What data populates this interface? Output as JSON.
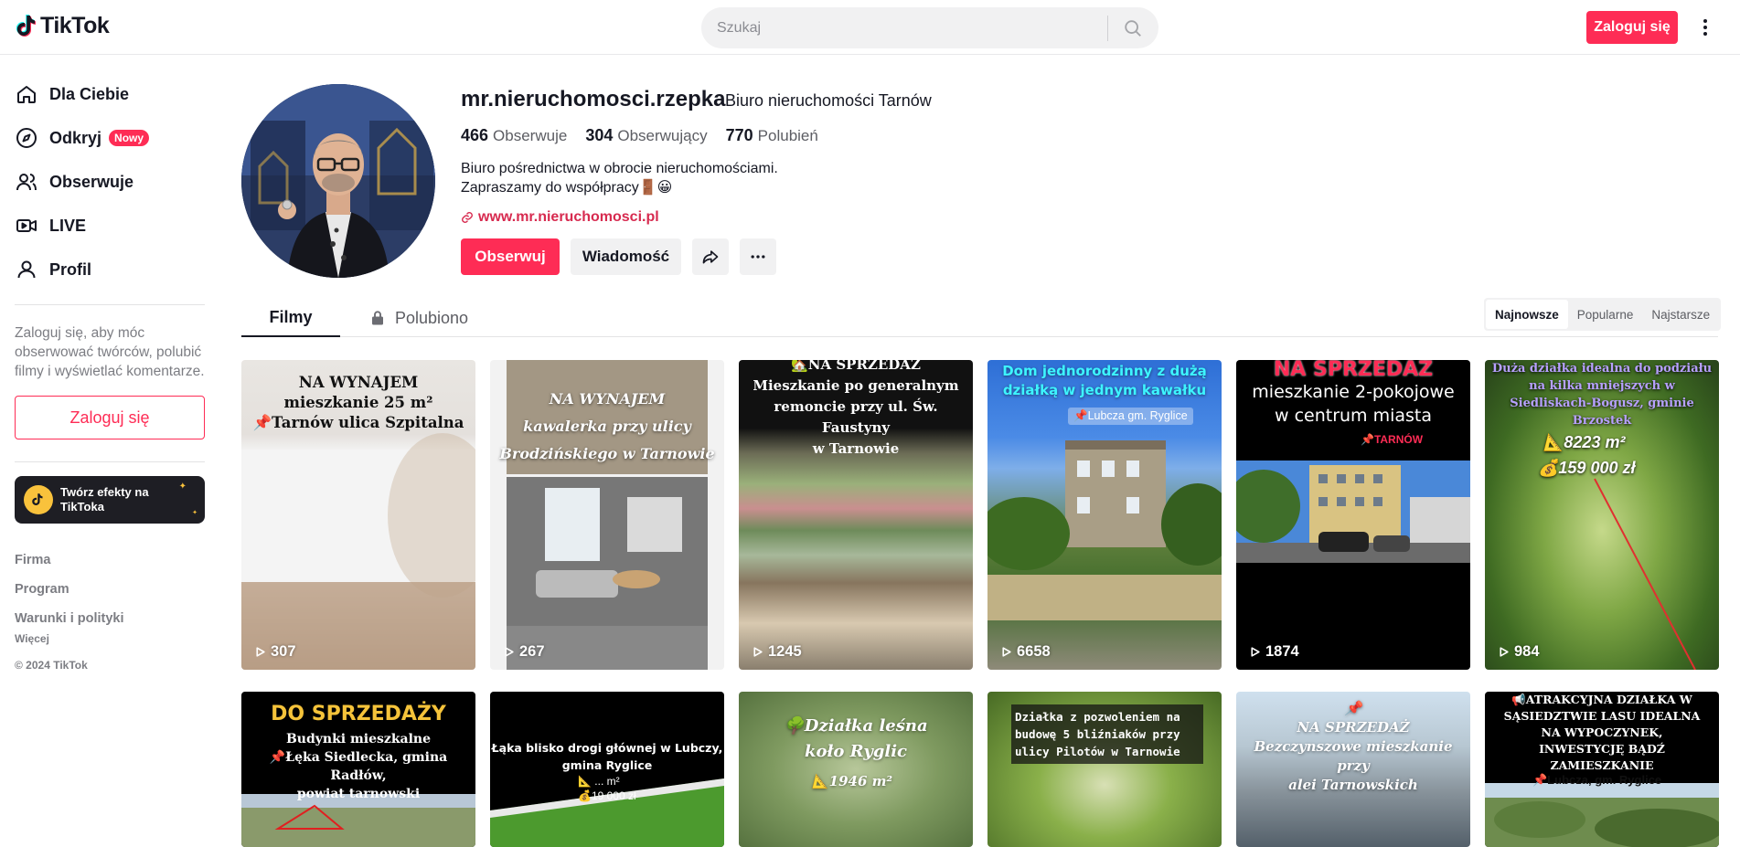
{
  "header": {
    "logo_text": "TikTok",
    "search_placeholder": "Szukaj",
    "login_label": "Zaloguj się"
  },
  "sidebar": {
    "items": [
      {
        "label": "Dla Ciebie",
        "icon": "home-icon"
      },
      {
        "label": "Odkryj",
        "icon": "compass-icon",
        "badge": "Nowy"
      },
      {
        "label": "Obserwuje",
        "icon": "users-icon"
      },
      {
        "label": "LIVE",
        "icon": "live-icon"
      },
      {
        "label": "Profil",
        "icon": "user-icon"
      }
    ],
    "login_hint": "Zaloguj się, aby móc obserwować twórców, polubić filmy i wyświetlać komentarze.",
    "login_label": "Zaloguj się",
    "effects_label": "Twórz efekty na TikToka",
    "footer": [
      "Firma",
      "Program",
      "Warunki i polityki"
    ],
    "more": "Więcej",
    "copyright": "© 2024 TikTok"
  },
  "profile": {
    "username": "mr.nieruchomosci.rzepka",
    "nickname": "Biuro nieruchomości Tarnów",
    "following_count": "466",
    "following_label": "Obserwuje",
    "followers_count": "304",
    "followers_label": "Obserwujący",
    "likes_count": "770",
    "likes_label": "Polubień",
    "bio_line1": "Biuro pośrednictwa w obrocie nieruchomościami.",
    "bio_line2": "Zapraszamy do współpracy🚪😀",
    "link": "www.mr.nieruchomosci.pl",
    "follow_label": "Obserwuj",
    "message_label": "Wiadomość"
  },
  "tabs": {
    "videos": "Filmy",
    "liked": "Polubiono"
  },
  "sort": [
    "Najnowsze",
    "Popularne",
    "Najstarsze"
  ],
  "videos": [
    {
      "caption": "NA WYNAJEM\nmieszkanie 25 m²\n📌Tarnów ulica Szpitalna",
      "views": "307"
    },
    {
      "caption": "NA WYNAJEM\nkawalerka przy ulicy\nBrodzińskiego w Tarnowie",
      "views": "267"
    },
    {
      "caption": "🏡NA SPRZEDAŻ\nMieszkanie po generalnym\nremoncie przy ul. Św. Faustyny\nw Tarnowie",
      "views": "1245"
    },
    {
      "caption": "Dom jednorodzinny z dużą\ndziałką w jednym kawałku",
      "tag": "📌Lubcza gm. Ryglice",
      "views": "6658"
    },
    {
      "caption": "NA SPRZEDAŻ",
      "subcaption": "mieszkanie 2-pokojowe\nw centrum miasta",
      "tag": "📌TARNÓW",
      "views": "1874"
    },
    {
      "caption": "Duża działka idealna do podziału\nna kilka mniejszych w\nSiedliskach-Bogusz, gminie\nBrzostek",
      "area": "📐8223 m²",
      "price": "💰159 000 zł",
      "views": "984"
    },
    {
      "caption": "DO SPRZEDAŻY",
      "subcaption": "Budynki mieszkalne\n📌Łęka Siedlecka, gmina Radłów,\npowiat tarnowski"
    },
    {
      "caption": "Łąka blisko drogi głównej w Lubczy,\ngmina Ryglice",
      "area": "📐 ... m²",
      "price": "💰19 000 zł"
    },
    {
      "caption": "🌳Działka leśna\nkoło Ryglic",
      "area": "📐1946 m²"
    },
    {
      "caption": "Działka z pozwoleniem na\nbudowę 5 bliźniaków przy\nulicy Pilotów w Tarnowie"
    },
    {
      "caption": "📌\nNA SPRZEDAŻ\nBezczynszowe mieszkanie przy\nalei Tarnowskich"
    },
    {
      "caption": "📢ATRAKCYJNA DZIAŁKA W\nSĄSIEDZTWIE LASU IDEALNA\nNA WYPOCZYNEK,\nINWESTYCJĘ BĄDŹ\nZAMIESZKANIE",
      "tag": "📌Lubcza, gm. Ryglice"
    }
  ],
  "colors": {
    "accent": "#fe2c55",
    "text": "#161823",
    "muted": "#7c7d83"
  }
}
